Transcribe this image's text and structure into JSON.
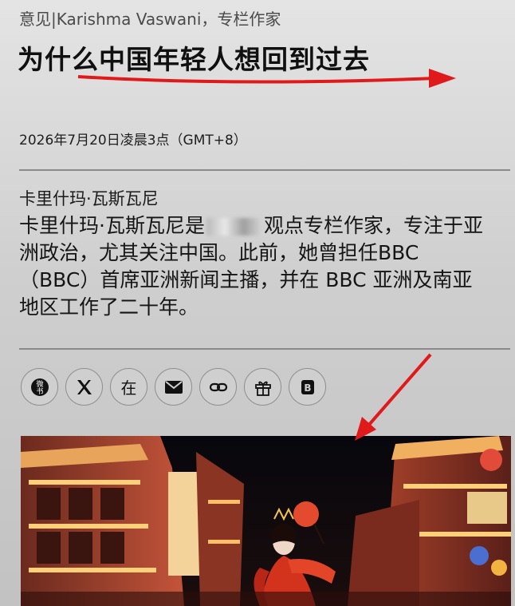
{
  "article": {
    "kicker": "意见|Karishma Vaswani，专栏作家",
    "title": "为什么中国年轻人想回到过去",
    "date": "2026年7月20日凌晨3点（GMT+8）"
  },
  "author": {
    "name": "卡里什玛·瓦斯瓦尼",
    "bio_part1": "卡里什玛·瓦斯瓦尼是",
    "bio_part2": "观点专栏作家，专注于亚洲政治，尤其关注中国。此前，她曾担任BBC（BBC）首席亚洲新闻主播，并在 BBC 亚洲及南亚地区工作了二十年。"
  },
  "share": {
    "buttons": [
      {
        "name": "weibo-share",
        "glyph": "微"
      },
      {
        "name": "x-share",
        "glyph": "𝕏"
      },
      {
        "name": "linkedin-share",
        "glyph": "在"
      },
      {
        "name": "email-share",
        "glyph": "✉"
      },
      {
        "name": "link-share",
        "glyph": "🔗"
      },
      {
        "name": "gift-share",
        "glyph": "🎁"
      },
      {
        "name": "bookmark-share",
        "glyph": "B"
      }
    ]
  },
  "colors": {
    "annotation_red": "#e0191b"
  }
}
